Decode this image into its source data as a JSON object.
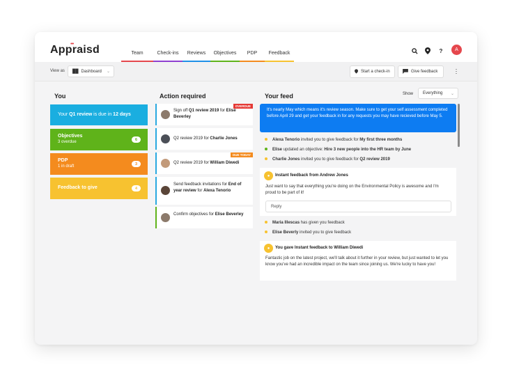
{
  "app": {
    "logo": "Appraisd",
    "avatar_initial": "A"
  },
  "nav": {
    "tabs": [
      {
        "label": "Team",
        "color": "#e5474d"
      },
      {
        "label": "Check-ins",
        "color": "#8e3fd0"
      },
      {
        "label": "Reviews",
        "color": "#1e90e8"
      },
      {
        "label": "Objectives",
        "color": "#5fb31a"
      },
      {
        "label": "PDP",
        "color": "#f48b1e"
      },
      {
        "label": "Feedback",
        "color": "#f7c230"
      }
    ]
  },
  "toolbar": {
    "view_as_label": "View as",
    "view_select": "Dashboard",
    "start_checkin": "Start a check-in",
    "give_feedback": "Give feedback"
  },
  "you": {
    "title": "You",
    "review_prefix": "Your",
    "review_name": "Q1 review",
    "review_mid": "is due in",
    "review_days": "12 days",
    "objectives": {
      "title": "Objectives",
      "sub": "3 overdue",
      "count": "6"
    },
    "pdp": {
      "title": "PDP",
      "sub": "1 in draft",
      "count": "3"
    },
    "feedback": {
      "title": "Feedback to give",
      "count": "4"
    }
  },
  "actions": {
    "title": "Action required",
    "items": [
      {
        "pre": "Sign off",
        "bold": "Q1 review 2019",
        "mid": "for",
        "bold2": "Elise Beverley",
        "tag": "OVERDUE",
        "tag_color": "#e53935"
      },
      {
        "pre": "Q2 review 2019",
        "mid": "for",
        "bold2": "Charlie Jones"
      },
      {
        "pre": "Q2 review 2019",
        "mid": "for",
        "bold2": "William Diwedi",
        "tag": "DUE TODAY",
        "tag_color": "#f48b1e"
      },
      {
        "pre": "Send feedback invitations for",
        "bold": "End of year review",
        "mid": "for",
        "bold2": "Alexa Tenorio"
      },
      {
        "pre": "Confirm objectives for",
        "bold2": "Elise Beverley"
      }
    ]
  },
  "feed": {
    "title": "Your feed",
    "show_label": "Show",
    "show_select": "Everything",
    "banner": "It's nearly May which means it's review season. Make sure to get your self assessment completed before April 29 and get your feedback in for any requests you may have recieved before May 5.",
    "lines1": [
      {
        "who": "Alexa Tenorio",
        "text": "invited you to give feedback for",
        "what": "My first three months",
        "dot": "#f7c230"
      },
      {
        "who": "Elise",
        "text": "updated an objective:",
        "what": "Hire 3 new people into the HR team by June",
        "dot": "#5fb31a"
      },
      {
        "who": "Charlie Jones",
        "text": "invited you to give feedback for",
        "what": "Q2 review 2019",
        "dot": "#f7c230"
      }
    ],
    "card1": {
      "title": "Instant feedback from Andrew Jones",
      "body": "Just want to say that everything you're doing on the Environmental Policy is awesome and I'm proud to be part of it!",
      "reply": "Reply"
    },
    "lines2": [
      {
        "who": "Maria Illescas",
        "text": "has given you feedback",
        "dot": "#f7c230"
      },
      {
        "who": "Elise Beverly",
        "text": "invited you to give feedback",
        "dot": "#f7c230"
      }
    ],
    "card2": {
      "title": "You gave Instant feedback to William Diwedi",
      "body": "Fantastic job on the latest project, we'll talk about it further in your review, but just wanted to let you know you've had an incredible impact on the team since joining us. We're lucky to have you!"
    }
  }
}
